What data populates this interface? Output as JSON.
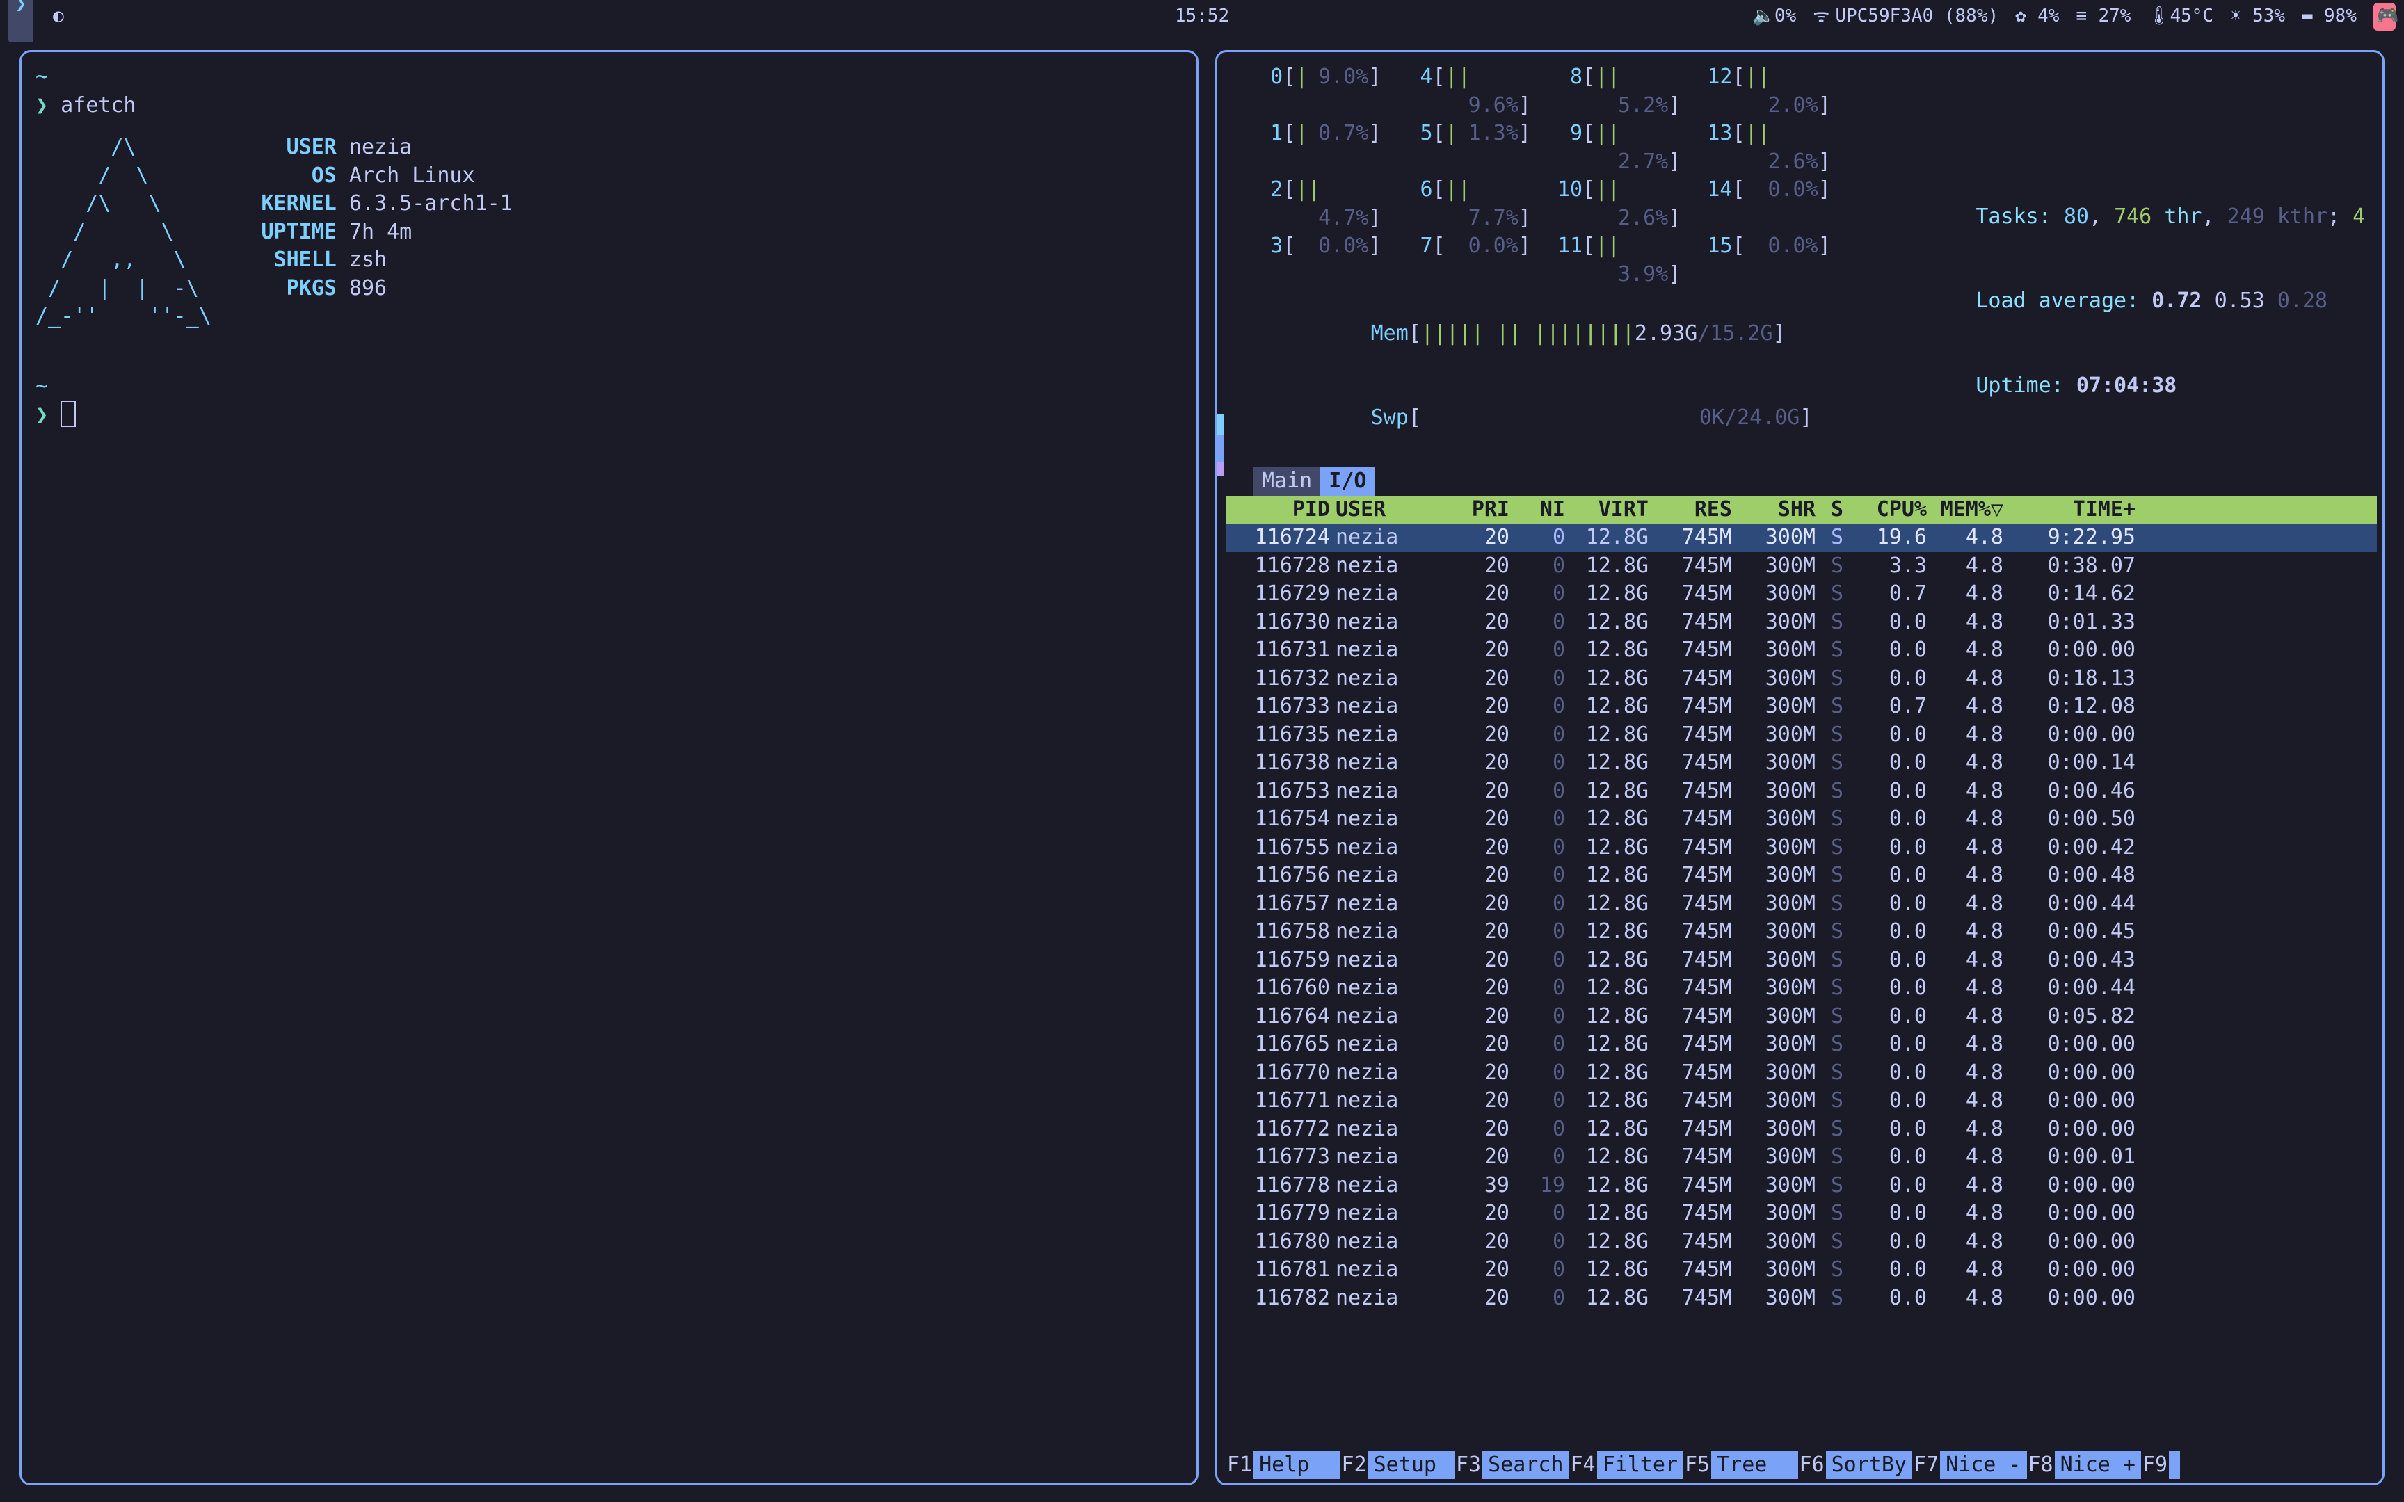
{
  "topbar": {
    "clock": "15:52",
    "volume_pct": "0%",
    "wifi": "UPC59F3A0 (88%)",
    "gear_pct": "4%",
    "bars_pct": "27%",
    "temp": "45°C",
    "sun_pct": "53%",
    "battery_pct": "98%"
  },
  "term_left": {
    "tilde": "~",
    "prompt": "❯",
    "command": "afetch",
    "ascii": "      /\\\n     /  \\\n    /\\   \\\n   /      \\\n  /   ,,   \\\n /   |  |  -\\\n/_-''    ''-_\\",
    "info": [
      {
        "k": "USER",
        "v": "nezia"
      },
      {
        "k": "OS",
        "v": "Arch Linux"
      },
      {
        "k": "KERNEL",
        "v": "6.3.5-arch1-1"
      },
      {
        "k": "UPTIME",
        "v": "7h 4m"
      },
      {
        "k": "SHELL",
        "v": "zsh"
      },
      {
        "k": "PKGS",
        "v": "896"
      }
    ]
  },
  "htop": {
    "cpus": [
      {
        "n": "0",
        "bar": "|",
        "pct": "9.0%"
      },
      {
        "n": "4",
        "bar": "||",
        "pct": "9.6%"
      },
      {
        "n": "8",
        "bar": "||",
        "pct": "5.2%"
      },
      {
        "n": "12",
        "bar": "||",
        "pct": "2.0%"
      },
      {
        "n": "1",
        "bar": "|",
        "pct": "0.7%"
      },
      {
        "n": "5",
        "bar": "|",
        "pct": "1.3%"
      },
      {
        "n": "9",
        "bar": "||",
        "pct": "2.7%"
      },
      {
        "n": "13",
        "bar": "||",
        "pct": "2.6%"
      },
      {
        "n": "2",
        "bar": "||",
        "pct": "4.7%"
      },
      {
        "n": "6",
        "bar": "||",
        "pct": "7.7%"
      },
      {
        "n": "10",
        "bar": "||",
        "pct": "2.6%"
      },
      {
        "n": "14",
        "bar": "",
        "pct": "0.0%"
      },
      {
        "n": "3",
        "bar": "",
        "pct": "0.0%"
      },
      {
        "n": "7",
        "bar": "",
        "pct": "0.0%"
      },
      {
        "n": "11",
        "bar": "||",
        "pct": "3.9%"
      },
      {
        "n": "15",
        "bar": "",
        "pct": "0.0%"
      }
    ],
    "mem": {
      "label": "Mem",
      "bar": "||||| || ||||||||",
      "used": "2.93G",
      "total": "15.2G"
    },
    "swp": {
      "label": "Swp",
      "used": "0K",
      "total": "24.0G"
    },
    "tasks": {
      "label": "Tasks:",
      "procs": "80",
      "thr": "746",
      "thr_lbl": "thr",
      "kthr": "249 kthr",
      "running": "4"
    },
    "load": {
      "label": "Load average:",
      "l1": "0.72",
      "l2": "0.53",
      "l3": "0.28"
    },
    "uptime": {
      "label": "Uptime:",
      "value": "07:04:38"
    },
    "tabs": {
      "main": "Main",
      "io": "I/O"
    },
    "headers": {
      "pid": "PID",
      "user": "USER",
      "pri": "PRI",
      "ni": "NI",
      "virt": "VIRT",
      "res": "RES",
      "shr": "SHR",
      "s": "S",
      "cpu": "CPU%",
      "mem": "MEM%▽",
      "time": "TIME+"
    },
    "rows": [
      {
        "pid": "116724",
        "user": "nezia",
        "pri": "20",
        "ni": "0",
        "virt": "12.8G",
        "res": "745M",
        "shr": "300M",
        "s": "S",
        "cpu": "19.6",
        "mem": "4.8",
        "time": "9:22.95",
        "sel": true
      },
      {
        "pid": "116728",
        "user": "nezia",
        "pri": "20",
        "ni": "0",
        "virt": "12.8G",
        "res": "745M",
        "shr": "300M",
        "s": "S",
        "cpu": "3.3",
        "mem": "4.8",
        "time": "0:38.07"
      },
      {
        "pid": "116729",
        "user": "nezia",
        "pri": "20",
        "ni": "0",
        "virt": "12.8G",
        "res": "745M",
        "shr": "300M",
        "s": "S",
        "cpu": "0.7",
        "mem": "4.8",
        "time": "0:14.62"
      },
      {
        "pid": "116730",
        "user": "nezia",
        "pri": "20",
        "ni": "0",
        "virt": "12.8G",
        "res": "745M",
        "shr": "300M",
        "s": "S",
        "cpu": "0.0",
        "mem": "4.8",
        "time": "0:01.33"
      },
      {
        "pid": "116731",
        "user": "nezia",
        "pri": "20",
        "ni": "0",
        "virt": "12.8G",
        "res": "745M",
        "shr": "300M",
        "s": "S",
        "cpu": "0.0",
        "mem": "4.8",
        "time": "0:00.00"
      },
      {
        "pid": "116732",
        "user": "nezia",
        "pri": "20",
        "ni": "0",
        "virt": "12.8G",
        "res": "745M",
        "shr": "300M",
        "s": "S",
        "cpu": "0.0",
        "mem": "4.8",
        "time": "0:18.13"
      },
      {
        "pid": "116733",
        "user": "nezia",
        "pri": "20",
        "ni": "0",
        "virt": "12.8G",
        "res": "745M",
        "shr": "300M",
        "s": "S",
        "cpu": "0.7",
        "mem": "4.8",
        "time": "0:12.08"
      },
      {
        "pid": "116735",
        "user": "nezia",
        "pri": "20",
        "ni": "0",
        "virt": "12.8G",
        "res": "745M",
        "shr": "300M",
        "s": "S",
        "cpu": "0.0",
        "mem": "4.8",
        "time": "0:00.00"
      },
      {
        "pid": "116738",
        "user": "nezia",
        "pri": "20",
        "ni": "0",
        "virt": "12.8G",
        "res": "745M",
        "shr": "300M",
        "s": "S",
        "cpu": "0.0",
        "mem": "4.8",
        "time": "0:00.14"
      },
      {
        "pid": "116753",
        "user": "nezia",
        "pri": "20",
        "ni": "0",
        "virt": "12.8G",
        "res": "745M",
        "shr": "300M",
        "s": "S",
        "cpu": "0.0",
        "mem": "4.8",
        "time": "0:00.46"
      },
      {
        "pid": "116754",
        "user": "nezia",
        "pri": "20",
        "ni": "0",
        "virt": "12.8G",
        "res": "745M",
        "shr": "300M",
        "s": "S",
        "cpu": "0.0",
        "mem": "4.8",
        "time": "0:00.50"
      },
      {
        "pid": "116755",
        "user": "nezia",
        "pri": "20",
        "ni": "0",
        "virt": "12.8G",
        "res": "745M",
        "shr": "300M",
        "s": "S",
        "cpu": "0.0",
        "mem": "4.8",
        "time": "0:00.42"
      },
      {
        "pid": "116756",
        "user": "nezia",
        "pri": "20",
        "ni": "0",
        "virt": "12.8G",
        "res": "745M",
        "shr": "300M",
        "s": "S",
        "cpu": "0.0",
        "mem": "4.8",
        "time": "0:00.48"
      },
      {
        "pid": "116757",
        "user": "nezia",
        "pri": "20",
        "ni": "0",
        "virt": "12.8G",
        "res": "745M",
        "shr": "300M",
        "s": "S",
        "cpu": "0.0",
        "mem": "4.8",
        "time": "0:00.44"
      },
      {
        "pid": "116758",
        "user": "nezia",
        "pri": "20",
        "ni": "0",
        "virt": "12.8G",
        "res": "745M",
        "shr": "300M",
        "s": "S",
        "cpu": "0.0",
        "mem": "4.8",
        "time": "0:00.45"
      },
      {
        "pid": "116759",
        "user": "nezia",
        "pri": "20",
        "ni": "0",
        "virt": "12.8G",
        "res": "745M",
        "shr": "300M",
        "s": "S",
        "cpu": "0.0",
        "mem": "4.8",
        "time": "0:00.43"
      },
      {
        "pid": "116760",
        "user": "nezia",
        "pri": "20",
        "ni": "0",
        "virt": "12.8G",
        "res": "745M",
        "shr": "300M",
        "s": "S",
        "cpu": "0.0",
        "mem": "4.8",
        "time": "0:00.44"
      },
      {
        "pid": "116764",
        "user": "nezia",
        "pri": "20",
        "ni": "0",
        "virt": "12.8G",
        "res": "745M",
        "shr": "300M",
        "s": "S",
        "cpu": "0.0",
        "mem": "4.8",
        "time": "0:05.82"
      },
      {
        "pid": "116765",
        "user": "nezia",
        "pri": "20",
        "ni": "0",
        "virt": "12.8G",
        "res": "745M",
        "shr": "300M",
        "s": "S",
        "cpu": "0.0",
        "mem": "4.8",
        "time": "0:00.00"
      },
      {
        "pid": "116770",
        "user": "nezia",
        "pri": "20",
        "ni": "0",
        "virt": "12.8G",
        "res": "745M",
        "shr": "300M",
        "s": "S",
        "cpu": "0.0",
        "mem": "4.8",
        "time": "0:00.00"
      },
      {
        "pid": "116771",
        "user": "nezia",
        "pri": "20",
        "ni": "0",
        "virt": "12.8G",
        "res": "745M",
        "shr": "300M",
        "s": "S",
        "cpu": "0.0",
        "mem": "4.8",
        "time": "0:00.00"
      },
      {
        "pid": "116772",
        "user": "nezia",
        "pri": "20",
        "ni": "0",
        "virt": "12.8G",
        "res": "745M",
        "shr": "300M",
        "s": "S",
        "cpu": "0.0",
        "mem": "4.8",
        "time": "0:00.00"
      },
      {
        "pid": "116773",
        "user": "nezia",
        "pri": "20",
        "ni": "0",
        "virt": "12.8G",
        "res": "745M",
        "shr": "300M",
        "s": "S",
        "cpu": "0.0",
        "mem": "4.8",
        "time": "0:00.01"
      },
      {
        "pid": "116778",
        "user": "nezia",
        "pri": "39",
        "ni": "19",
        "virt": "12.8G",
        "res": "745M",
        "shr": "300M",
        "s": "S",
        "cpu": "0.0",
        "mem": "4.8",
        "time": "0:00.00",
        "ni_hl": true
      },
      {
        "pid": "116779",
        "user": "nezia",
        "pri": "20",
        "ni": "0",
        "virt": "12.8G",
        "res": "745M",
        "shr": "300M",
        "s": "S",
        "cpu": "0.0",
        "mem": "4.8",
        "time": "0:00.00"
      },
      {
        "pid": "116780",
        "user": "nezia",
        "pri": "20",
        "ni": "0",
        "virt": "12.8G",
        "res": "745M",
        "shr": "300M",
        "s": "S",
        "cpu": "0.0",
        "mem": "4.8",
        "time": "0:00.00"
      },
      {
        "pid": "116781",
        "user": "nezia",
        "pri": "20",
        "ni": "0",
        "virt": "12.8G",
        "res": "745M",
        "shr": "300M",
        "s": "S",
        "cpu": "0.0",
        "mem": "4.8",
        "time": "0:00.00"
      },
      {
        "pid": "116782",
        "user": "nezia",
        "pri": "20",
        "ni": "0",
        "virt": "12.8G",
        "res": "745M",
        "shr": "300M",
        "s": "S",
        "cpu": "0.0",
        "mem": "4.8",
        "time": "0:00.00"
      }
    ],
    "fkeys": [
      {
        "fn": "F1",
        "lbl": "Help  "
      },
      {
        "fn": "F2",
        "lbl": "Setup "
      },
      {
        "fn": "F3",
        "lbl": "Search"
      },
      {
        "fn": "F4",
        "lbl": "Filter"
      },
      {
        "fn": "F5",
        "lbl": "Tree  "
      },
      {
        "fn": "F6",
        "lbl": "SortBy"
      },
      {
        "fn": "F7",
        "lbl": "Nice -"
      },
      {
        "fn": "F8",
        "lbl": "Nice +"
      },
      {
        "fn": "F9",
        "lbl": ""
      }
    ]
  }
}
